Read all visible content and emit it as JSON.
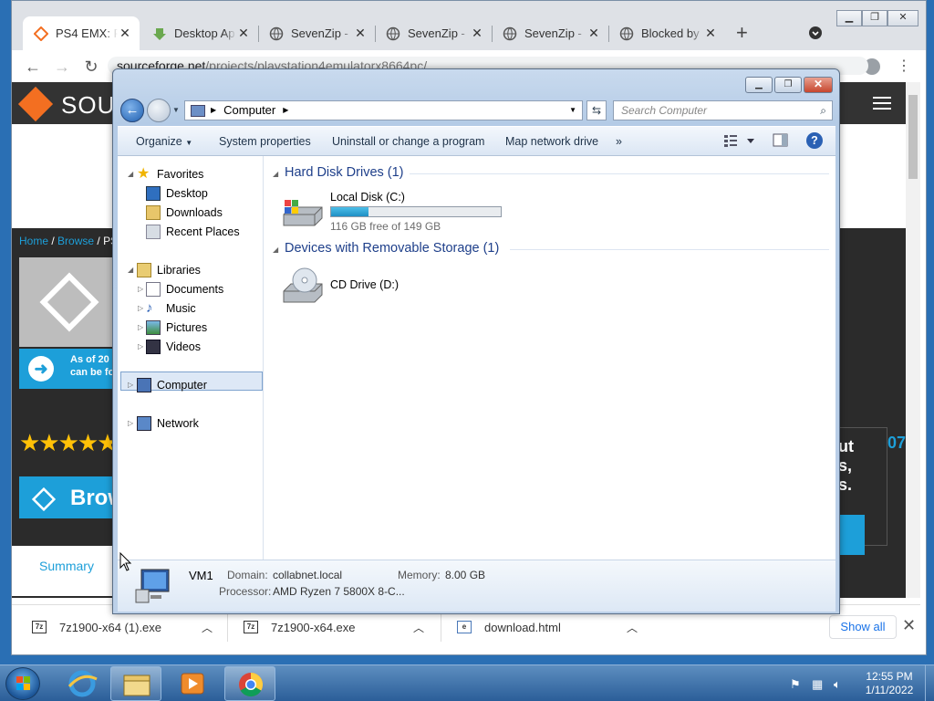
{
  "browser": {
    "tabs": [
      {
        "title": "PS4 EMX: Pl",
        "icon": "sourceforge-icon"
      },
      {
        "title": "Desktop Ap",
        "icon": "download-icon"
      },
      {
        "title": "SevenZip - ",
        "icon": "globe-icon"
      },
      {
        "title": "SevenZip - ",
        "icon": "globe-icon"
      },
      {
        "title": "SevenZip - ",
        "icon": "globe-icon"
      },
      {
        "title": "Blocked by ",
        "icon": "globe-icon"
      }
    ],
    "new_tab": "+",
    "url_host": "sourceforge.net",
    "url_path": "/projects/playstation4emulatorx8664pc/"
  },
  "page": {
    "brand": "SOUR",
    "breadcrumb_home": "Home",
    "breadcrumb_browse": "Browse",
    "breadcrumb_rest": "PS",
    "notice_line1": "As of 20",
    "notice_line2": "can be fo",
    "browse_button": "Brow",
    "card_lines": [
      "ut",
      "s,",
      "s."
    ],
    "card_number": "07",
    "summary_tab": "Summary"
  },
  "downloads": {
    "items": [
      {
        "name": "7z1900-x64 (1).exe"
      },
      {
        "name": "7z1900-x64.exe"
      },
      {
        "name": "download.html"
      }
    ],
    "show_all": "Show all"
  },
  "explorer": {
    "address": "Computer",
    "search_placeholder": "Search Computer",
    "commands": {
      "organize": "Organize",
      "system_properties": "System properties",
      "uninstall": "Uninstall or change a program",
      "map_drive": "Map network drive",
      "more": "»"
    },
    "nav": {
      "favorites": "Favorites",
      "desktop": "Desktop",
      "downloads": "Downloads",
      "recent": "Recent Places",
      "libraries": "Libraries",
      "documents": "Documents",
      "music": "Music",
      "pictures": "Pictures",
      "videos": "Videos",
      "computer": "Computer",
      "network": "Network"
    },
    "groups": {
      "hdd": "Hard Disk Drives (1)",
      "removable": "Devices with Removable Storage (1)"
    },
    "drives": {
      "c_name": "Local Disk (C:)",
      "c_free": "116 GB free of 149 GB",
      "c_used_fraction": 0.22,
      "d_name": "CD Drive (D:)"
    },
    "details": {
      "name": "VM1",
      "domain_label": "Domain:",
      "domain_value": "collabnet.local",
      "memory_label": "Memory:",
      "memory_value": "8.00 GB",
      "processor_label": "Processor:",
      "processor_value": "AMD Ryzen 7 5800X 8-C..."
    }
  },
  "taskbar": {
    "time": "12:55 PM",
    "date": "1/11/2022"
  },
  "colors": {
    "accent": "#1d9fd9",
    "sourceforge_orange": "#f36f21",
    "explorer_link": "#1e3f8a"
  }
}
